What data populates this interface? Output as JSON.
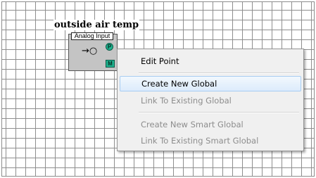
{
  "point": {
    "title": "outside air temp",
    "block_label": "Analog Input",
    "input_glyph": "→○",
    "badge_p": "P",
    "badge_m": "M",
    "icons": {
      "input": "input-connector-icon",
      "point": "point-badge-icon",
      "monitor": "monitor-badge-icon"
    }
  },
  "context_menu": {
    "items": [
      {
        "label": "Edit Point",
        "enabled": true
      },
      {
        "label": "Create New Global",
        "enabled": true,
        "highlighted": true
      },
      {
        "label": "Link To Existing Global",
        "enabled": false
      },
      {
        "label": "Create New Smart Global",
        "enabled": false
      },
      {
        "label": "Link To Existing Smart Global",
        "enabled": false
      }
    ]
  },
  "colors": {
    "grid_line": "#8e8e8e",
    "block_fill": "#c4c4c4",
    "badge_fill": "#1fb28f",
    "menu_bg": "#f0f0f0",
    "menu_highlight": "#dcebfc",
    "disabled_text": "#8d8d8d"
  }
}
